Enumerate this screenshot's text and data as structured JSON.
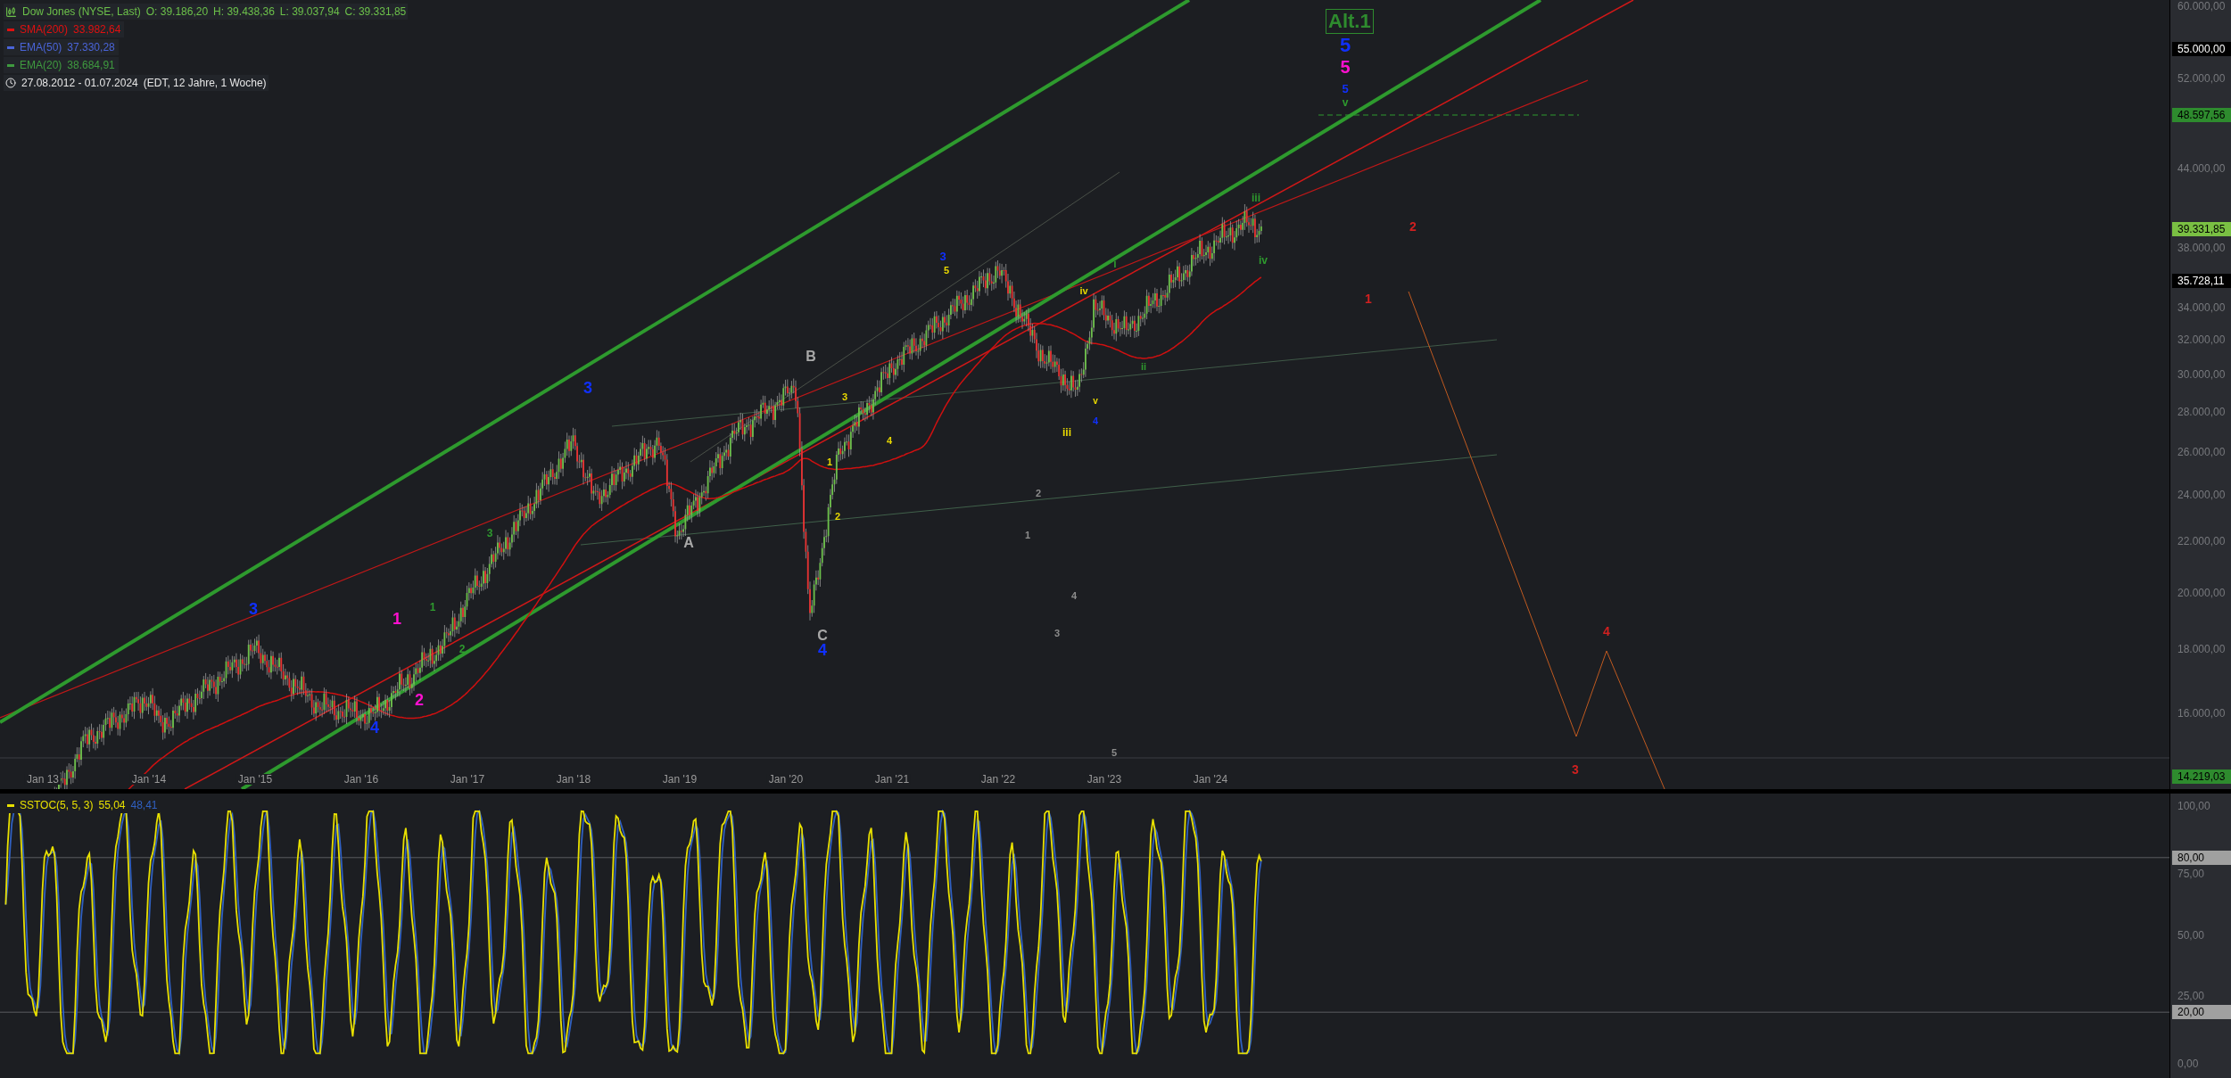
{
  "legend": {
    "instrument": {
      "name": "Dow Jones (NYSE, Last)",
      "open": "O: 39.186,20",
      "high": "H: 39.438,36",
      "low": "L: 39.037,94",
      "close": "C: 39.331,85"
    },
    "indicators": [
      {
        "name": "SMA(200)",
        "value": "33.982,64",
        "color": "#e01010"
      },
      {
        "name": "EMA(50)",
        "value": "37.330,28",
        "color": "#4a64d8"
      },
      {
        "name": "EMA(20)",
        "value": "38.684,91",
        "color": "#3f9a3f"
      }
    ],
    "range": {
      "dates": "27.08.2012 - 01.07.2024",
      "details": "(EDT, 12 Jahre, 1 Woche)"
    }
  },
  "annotation_box": {
    "label": "Alt.1"
  },
  "wave_labels": [
    {
      "text": "5",
      "color": "#1030ff"
    },
    {
      "text": "5",
      "color": "#ff10d0"
    },
    {
      "text": "5",
      "color": "#1030ff"
    },
    {
      "text": "v",
      "color": "#2e9a2e"
    },
    {
      "text": "iii",
      "color": "#2e9a2e"
    },
    {
      "text": "iv",
      "color": "#2e9a2e"
    },
    {
      "text": "2",
      "color": "#d02020"
    },
    {
      "text": "1",
      "color": "#d02020"
    },
    {
      "text": "4",
      "color": "#d02020"
    },
    {
      "text": "3",
      "color": "#d02020"
    },
    {
      "text": "B",
      "color": "#a8a8a8"
    },
    {
      "text": "A",
      "color": "#a8a8a8"
    },
    {
      "text": "C",
      "color": "#a8a8a8"
    },
    {
      "text": "4",
      "color": "#1030ff"
    },
    {
      "text": "3",
      "color": "#1030ff"
    },
    {
      "text": "3",
      "color": "#1030ff"
    },
    {
      "text": "4",
      "color": "#1030ff"
    },
    {
      "text": "1",
      "color": "#ff10d0"
    },
    {
      "text": "2",
      "color": "#ff10d0"
    },
    {
      "text": "3",
      "color": "#1030ff"
    },
    {
      "text": "5",
      "color": "#e8d800"
    },
    {
      "text": "1",
      "color": "#e8d800"
    },
    {
      "text": "2",
      "color": "#e8d800"
    },
    {
      "text": "3",
      "color": "#e8d800"
    },
    {
      "text": "4",
      "color": "#e8d800"
    },
    {
      "text": "iv",
      "color": "#e8d800"
    },
    {
      "text": "iii",
      "color": "#e8d800"
    },
    {
      "text": "v",
      "color": "#e8d800"
    },
    {
      "text": "4",
      "color": "#1030ff"
    },
    {
      "text": "i",
      "color": "#2e9a2e"
    },
    {
      "text": "ii",
      "color": "#2e9a2e"
    },
    {
      "text": "1",
      "color": "#2e9a2e"
    },
    {
      "text": "2",
      "color": "#2e9a2e"
    },
    {
      "text": "3",
      "color": "#2e9a2e"
    },
    {
      "text": "2",
      "color": "#8c8c8c"
    },
    {
      "text": "1",
      "color": "#8c8c8c"
    },
    {
      "text": "4",
      "color": "#8c8c8c"
    },
    {
      "text": "3",
      "color": "#8c8c8c"
    },
    {
      "text": "5",
      "color": "#8c8c8c"
    }
  ],
  "price_axis": {
    "ticks": [
      "60.000,00",
      "52.000,00",
      "44.000,00",
      "38.000,00",
      "34.000,00",
      "32.000,00",
      "30.000,00",
      "28.000,00",
      "26.000,00",
      "24.000,00",
      "22.000,00",
      "20.000,00",
      "18.000,00",
      "16.000,00"
    ],
    "markers": [
      {
        "label": "55.000,00",
        "color": "#000000"
      },
      {
        "label": "48.597,56",
        "color": "#2e8b2e"
      },
      {
        "label": "39.331,85",
        "color": "#7ac043"
      },
      {
        "label": "35.728,11",
        "color": "#000000"
      },
      {
        "label": "14.219,03",
        "color": "#2e8b2e"
      }
    ]
  },
  "time_axis": {
    "ticks": [
      "Jan 13",
      "Jan '14",
      "Jan '15",
      "Jan '16",
      "Jan '17",
      "Jan '18",
      "Jan '19",
      "Jan '20",
      "Jan '21",
      "Jan '22",
      "Jan '23",
      "Jan '24"
    ]
  },
  "oscillator": {
    "name": "SSTOC(5, 5, 3)",
    "values": [
      {
        "value": "55,04",
        "color": "#e8e000"
      },
      {
        "value": "48,41",
        "color": "#3060c0"
      }
    ],
    "ticks": [
      "100,00",
      "75,00",
      "50,00",
      "25,00",
      "0,00"
    ],
    "markers": [
      {
        "label": "80,00"
      },
      {
        "label": "20,00"
      }
    ]
  }
}
